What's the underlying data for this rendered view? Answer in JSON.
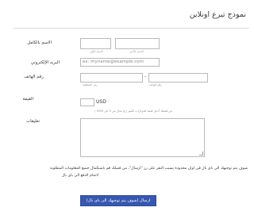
{
  "form": {
    "title": "نموذج تبرع اونلاين",
    "fields": {
      "full_name": {
        "label": "الاسم بالكامل",
        "first_sub": "الاسم الأول",
        "last_sub": "الاسم الأخير"
      },
      "email": {
        "label": "البريد الإلكتروني",
        "placeholder": "ex: myname@example.com"
      },
      "phone": {
        "label": "رقم الهاتف",
        "area_sub": "رمز المنطقة",
        "number_sub": "رقم الهاتف",
        "separator": "-"
      },
      "amount": {
        "label": "القيمة",
        "currency": "USD",
        "hint": "من فضلك أدخل قيمة للدولارات الكبير (ج) مثال من 0 الي (500 )"
      },
      "comments": {
        "label": "تعليقات"
      }
    },
    "note": {
      "line1": "سوف يتم توجيهك الى باى بال في اوان محدودة بسبب النقر على زر \"ارسال\"، من فضلك قم باستكمال جميع المعلومات المطلوبة",
      "line2": "لاتمام الدفع الى باى بال"
    },
    "submit_label": "ارسال (سوف يتم توجيهك الى باى بال)"
  }
}
